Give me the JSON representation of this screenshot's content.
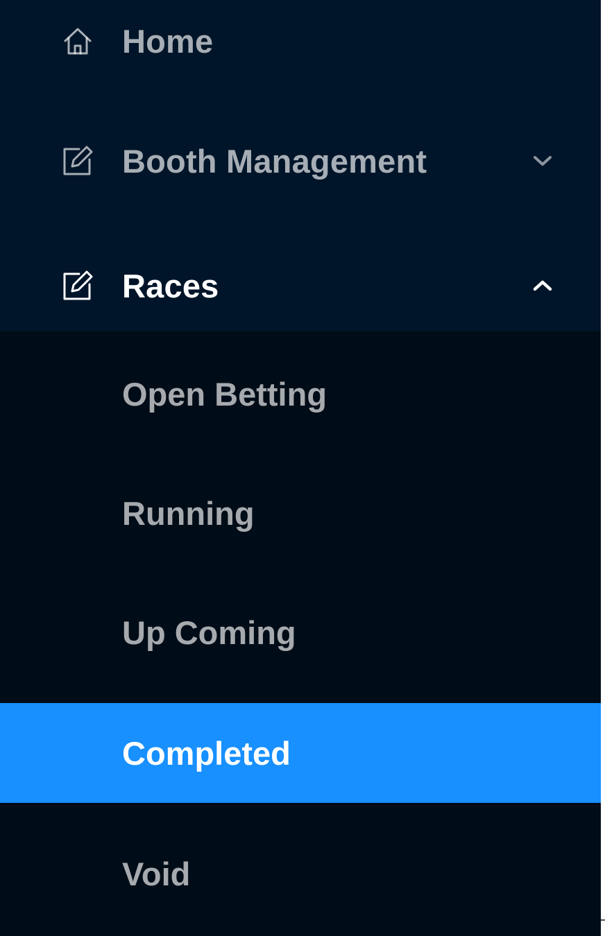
{
  "menu": {
    "top_items": [
      {
        "label": "Home",
        "icon": "home-icon",
        "expandable": false
      },
      {
        "label": "Booth Management",
        "icon": "edit-icon",
        "expandable": true,
        "expanded": false
      },
      {
        "label": "Races",
        "icon": "edit-icon",
        "expandable": true,
        "expanded": true
      }
    ],
    "races_submenu": [
      {
        "label": "Open Betting",
        "selected": false
      },
      {
        "label": "Running",
        "selected": false
      },
      {
        "label": "Up Coming",
        "selected": false
      },
      {
        "label": "Completed",
        "selected": true
      },
      {
        "label": "Void",
        "selected": false
      }
    ]
  },
  "colors": {
    "sider_bg": "#001529",
    "submenu_bg": "#000c17",
    "selected_bg": "#1890ff",
    "text_muted": "rgba(255,255,255,0.65)",
    "text_active": "#ffffff"
  }
}
